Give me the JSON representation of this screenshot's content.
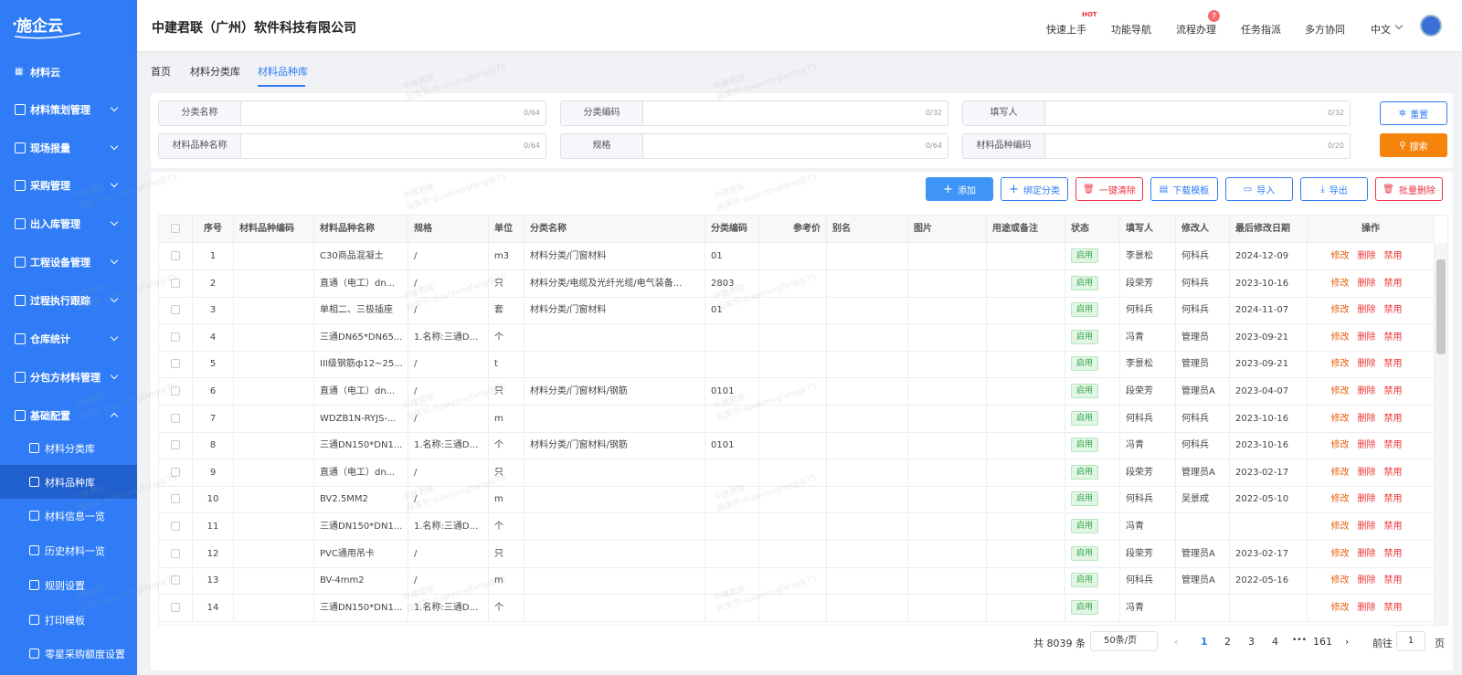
{
  "app": {
    "logo_text": "施企云",
    "company": "中建君联（广州）软件科技有限公司"
  },
  "colors": {
    "primary": "#2f7cf6",
    "sidebar_bg": "#2f7cf6",
    "sidebar_active": "#1f5fce",
    "orange": "#f5840c",
    "danger": "#ee3344",
    "success": "#35a64c"
  },
  "sidebar": {
    "items": [
      {
        "label": "材料云",
        "icon": "grid-icon",
        "expandable": false
      },
      {
        "label": "材料策划管理",
        "icon": "plan-icon",
        "expandable": true
      },
      {
        "label": "现场报量",
        "icon": "report-icon",
        "expandable": true
      },
      {
        "label": "采购管理",
        "icon": "purchase-icon",
        "expandable": true
      },
      {
        "label": "出入库管理",
        "icon": "warehouse-io-icon",
        "expandable": true
      },
      {
        "label": "工程设备管理",
        "icon": "equipment-icon",
        "expandable": true
      },
      {
        "label": "过程执行跟踪",
        "icon": "track-icon",
        "expandable": true
      },
      {
        "label": "仓库统计",
        "icon": "stats-icon",
        "expandable": true
      },
      {
        "label": "分包方材料管理",
        "icon": "subcontract-icon",
        "expandable": true
      },
      {
        "label": "基础配置",
        "icon": "config-icon",
        "expandable": true,
        "expanded": true
      }
    ],
    "subitems": [
      {
        "label": "材料分类库",
        "icon": "category-icon"
      },
      {
        "label": "材料品种库",
        "icon": "variety-icon",
        "active": true
      },
      {
        "label": "材料信息一览",
        "icon": "info-icon"
      },
      {
        "label": "历史材料一览",
        "icon": "history-icon"
      },
      {
        "label": "规则设置",
        "icon": "rule-icon"
      },
      {
        "label": "打印模板",
        "icon": "print-icon"
      },
      {
        "label": "零星采购额度设置",
        "icon": "quota-icon"
      }
    ]
  },
  "topnav": {
    "quick_start": "快速上手",
    "hot_badge": "HOT",
    "func_nav": "功能导航",
    "flow": "流程办理",
    "flow_badge": "7",
    "task": "任务指派",
    "collab": "多方协同",
    "lang": "中文"
  },
  "tabs": [
    "首页",
    "材料分类库",
    "材料品种库"
  ],
  "filters": {
    "cat_name": {
      "label": "分类名称",
      "count": "0/64"
    },
    "cat_code": {
      "label": "分类编码",
      "count": "0/32"
    },
    "writer": {
      "label": "填写人",
      "count": "0/32"
    },
    "variety_name": {
      "label": "材料品种名称",
      "count": "0/64"
    },
    "spec": {
      "label": "规格",
      "count": "0/64"
    },
    "variety_code": {
      "label": "材料品种编码",
      "count": "0/20"
    },
    "reset_label": "重置",
    "search_label": "搜索"
  },
  "toolbar": {
    "add": "添加",
    "bind": "绑定分类",
    "clear": "一键清除",
    "download": "下载模板",
    "import": "导入",
    "export": "导出",
    "batch_delete": "批量删除"
  },
  "table": {
    "headers": [
      "序号",
      "材料品种编码",
      "材料品种名称",
      "规格",
      "单位",
      "分类名称",
      "分类编码",
      "参考价",
      "别名",
      "图片",
      "用途或备注",
      "状态",
      "填写人",
      "修改人",
      "最后修改日期",
      "操作"
    ],
    "actions": {
      "edit": "修改",
      "delete": "删除",
      "disable": "禁用"
    },
    "rows": [
      {
        "no": "1",
        "code": "",
        "name": "C30商品混凝土",
        "spec": "/",
        "unit": "m3",
        "cat": "材料分类/门窗材料",
        "cat_code": "01",
        "status": "启用",
        "writer": "李景松",
        "modifier": "何科兵",
        "date": "2024-12-09"
      },
      {
        "no": "2",
        "code": "",
        "name": "直通（电工）dn...",
        "spec": "/",
        "unit": "只",
        "cat": "材料分类/电缆及光纤光缆/电气装备...",
        "cat_code": "2803",
        "status": "启用",
        "writer": "段荣芳",
        "modifier": "何科兵",
        "date": "2023-10-16"
      },
      {
        "no": "3",
        "code": "",
        "name": "单相二、三极插座",
        "spec": "/",
        "unit": "套",
        "cat": "材料分类/门窗材料",
        "cat_code": "01",
        "status": "启用",
        "writer": "何科兵",
        "modifier": "何科兵",
        "date": "2024-11-07"
      },
      {
        "no": "4",
        "code": "",
        "name": "三通DN65*DN65...",
        "spec": "1.名称:三通D...",
        "unit": "个",
        "cat": "",
        "cat_code": "",
        "status": "启用",
        "writer": "冯青",
        "modifier": "管理员",
        "date": "2023-09-21"
      },
      {
        "no": "5",
        "code": "",
        "name": "III级钢筋ф12~25...",
        "spec": "/",
        "unit": "t",
        "cat": "",
        "cat_code": "",
        "status": "启用",
        "writer": "李景松",
        "modifier": "管理员",
        "date": "2023-09-21"
      },
      {
        "no": "6",
        "code": "",
        "name": "直通（电工）dn...",
        "spec": "/",
        "unit": "只",
        "cat": "材料分类/门窗材料/钢筋",
        "cat_code": "0101",
        "status": "启用",
        "writer": "段荣芳",
        "modifier": "管理员A",
        "date": "2023-04-07"
      },
      {
        "no": "7",
        "code": "",
        "name": "WDZB1N-RYJS-...",
        "spec": "/",
        "unit": "m",
        "cat": "",
        "cat_code": "",
        "status": "启用",
        "writer": "何科兵",
        "modifier": "何科兵",
        "date": "2023-10-16"
      },
      {
        "no": "8",
        "code": "",
        "name": "三通DN150*DN1...",
        "spec": "1.名称:三通D...",
        "unit": "个",
        "cat": "材料分类/门窗材料/钢筋",
        "cat_code": "0101",
        "status": "启用",
        "writer": "冯青",
        "modifier": "何科兵",
        "date": "2023-10-16"
      },
      {
        "no": "9",
        "code": "",
        "name": "直通（电工）dn...",
        "spec": "/",
        "unit": "只",
        "cat": "",
        "cat_code": "",
        "status": "启用",
        "writer": "段荣芳",
        "modifier": "管理员A",
        "date": "2023-02-17"
      },
      {
        "no": "10",
        "code": "",
        "name": "BV2.5MM2",
        "spec": "/",
        "unit": "m",
        "cat": "",
        "cat_code": "",
        "status": "启用",
        "writer": "何科兵",
        "modifier": "吴景成",
        "date": "2022-05-10"
      },
      {
        "no": "11",
        "code": "",
        "name": "三通DN150*DN1...",
        "spec": "1.名称:三通D...",
        "unit": "个",
        "cat": "",
        "cat_code": "",
        "status": "启用",
        "writer": "冯青",
        "modifier": "",
        "date": ""
      },
      {
        "no": "12",
        "code": "",
        "name": "PVC通用吊卡",
        "spec": "/",
        "unit": "只",
        "cat": "",
        "cat_code": "",
        "status": "启用",
        "writer": "段荣芳",
        "modifier": "管理员A",
        "date": "2023-02-17"
      },
      {
        "no": "13",
        "code": "",
        "name": "BV-4mm2",
        "spec": "/",
        "unit": "m",
        "cat": "",
        "cat_code": "",
        "status": "启用",
        "writer": "何科兵",
        "modifier": "管理员A",
        "date": "2022-05-16"
      },
      {
        "no": "14",
        "code": "",
        "name": "三通DN150*DN1...",
        "spec": "1.名称:三通D...",
        "unit": "个",
        "cat": "",
        "cat_code": "",
        "status": "启用",
        "writer": "冯青",
        "modifier": "",
        "date": ""
      }
    ]
  },
  "pagination": {
    "total": "共 8039 条",
    "page_size": "50条/页",
    "pages": [
      "1",
      "2",
      "3",
      "4"
    ],
    "ellipsis": "•••",
    "last": "161",
    "goto_label": "前往",
    "goto_value": "1",
    "goto_suffix": "页"
  },
  "watermark": {
    "line1": "中建君联",
    "line2": "段荣芳-duanrongfang@75"
  }
}
